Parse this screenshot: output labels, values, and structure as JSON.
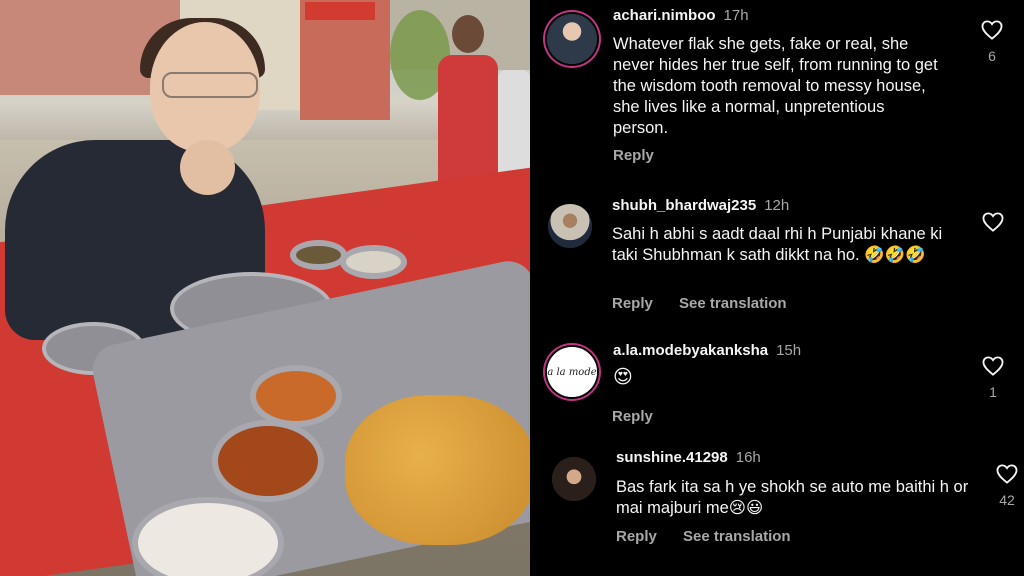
{
  "comments": [
    {
      "username": "achari.nimboo",
      "time": "17h",
      "text": "Whatever flak she gets, fake or real, she never hides her true self, from running to get the wisdom tooth removal to messy house, she lives like a normal, unpretentious person.",
      "reply": "Reply",
      "likes": "6"
    },
    {
      "username": "shubh_bhardwaj235",
      "time": "12h",
      "text": "Sahi h abhi s aadt daal rhi h Punjabi khane ki taki Shubhman k sath dikkt na ho. 🤣🤣🤣",
      "reply": "Reply",
      "see_translation": "See translation"
    },
    {
      "username": "a.la.modebyakanksha",
      "time": "15h",
      "text": "😍",
      "reply": "Reply",
      "likes": "1",
      "avatar_text": "a la mode"
    },
    {
      "username": "sunshine.41298",
      "time": "16h",
      "text": "Bas fark ita sa h ye shokh se auto me baithi h or mai majburi me😢😃",
      "reply": "Reply",
      "see_translation": "See translation",
      "likes": "42"
    }
  ],
  "icons": {
    "like": "heart-outline-icon"
  },
  "colors": {
    "background": "#000000",
    "text": "#f5f5f5",
    "muted": "#a8a8a8",
    "story_ring": "#c13584",
    "table_red": "#d03a33"
  }
}
